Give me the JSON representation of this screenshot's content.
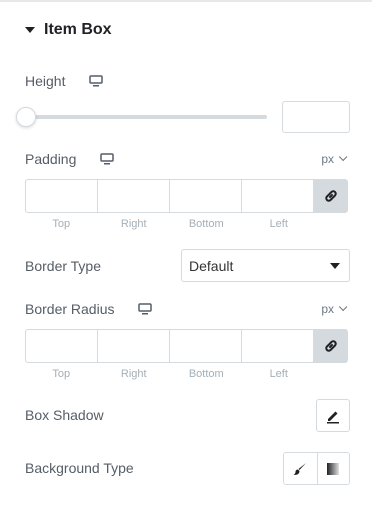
{
  "section": {
    "title": "Item Box",
    "caret_icon": "caret-down-icon"
  },
  "height": {
    "label": "Height",
    "device_icon": "desktop-icon",
    "slider_value": 0,
    "input_value": ""
  },
  "padding": {
    "label": "Padding",
    "device_icon": "desktop-icon",
    "unit": "px",
    "sides": [
      "Top",
      "Right",
      "Bottom",
      "Left"
    ],
    "values": [
      "",
      "",
      "",
      ""
    ],
    "link_icon": "link-icon"
  },
  "border_type": {
    "label": "Border Type",
    "selected": "Default"
  },
  "border_radius": {
    "label": "Border Radius",
    "device_icon": "desktop-icon",
    "unit": "px",
    "sides": [
      "Top",
      "Right",
      "Bottom",
      "Left"
    ],
    "values": [
      "",
      "",
      "",
      ""
    ],
    "link_icon": "link-icon"
  },
  "box_shadow": {
    "label": "Box Shadow",
    "edit_icon": "pencil-icon"
  },
  "background_type": {
    "label": "Background Type",
    "options": [
      "brush-icon",
      "gradient-icon"
    ]
  },
  "colors": {
    "border": "#d5dadf",
    "link_bg": "#d5dadf",
    "title": "#1f2124",
    "label": "#555d66",
    "sub_label": "#a4afb7"
  }
}
